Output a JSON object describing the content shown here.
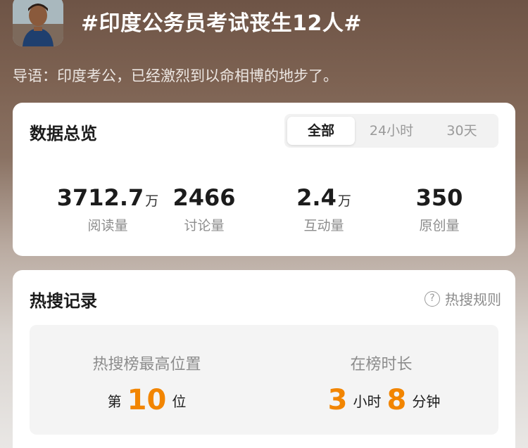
{
  "topic": {
    "title": "#印度公务员考试丧生12人#",
    "intro": "导语：印度考公，已经激烈到以命相博的地步了。"
  },
  "overview": {
    "title": "数据总览",
    "tabs": [
      {
        "label": "全部",
        "active": true
      },
      {
        "label": "24小时",
        "active": false
      },
      {
        "label": "30天",
        "active": false
      }
    ],
    "stats": [
      {
        "value": "3712.7",
        "unit": "万",
        "label": "阅读量"
      },
      {
        "value": "2466",
        "unit": "",
        "label": "讨论量"
      },
      {
        "value": "2.4",
        "unit": "万",
        "label": "互动量"
      },
      {
        "value": "350",
        "unit": "",
        "label": "原创量"
      }
    ]
  },
  "hot_search": {
    "title": "热搜记录",
    "rules_label": "热搜规则",
    "peak": {
      "label": "热搜榜最高位置",
      "prefix": "第",
      "value": "10",
      "suffix": "位"
    },
    "duration": {
      "label": "在榜时长",
      "hours": "3",
      "hours_unit": "小时",
      "minutes": "8",
      "minutes_unit": "分钟"
    }
  },
  "colors": {
    "accent": "#f28500",
    "text": "#1c1c1c",
    "muted": "#8c8c8c"
  },
  "icons": {
    "help": "question-circle-icon"
  }
}
